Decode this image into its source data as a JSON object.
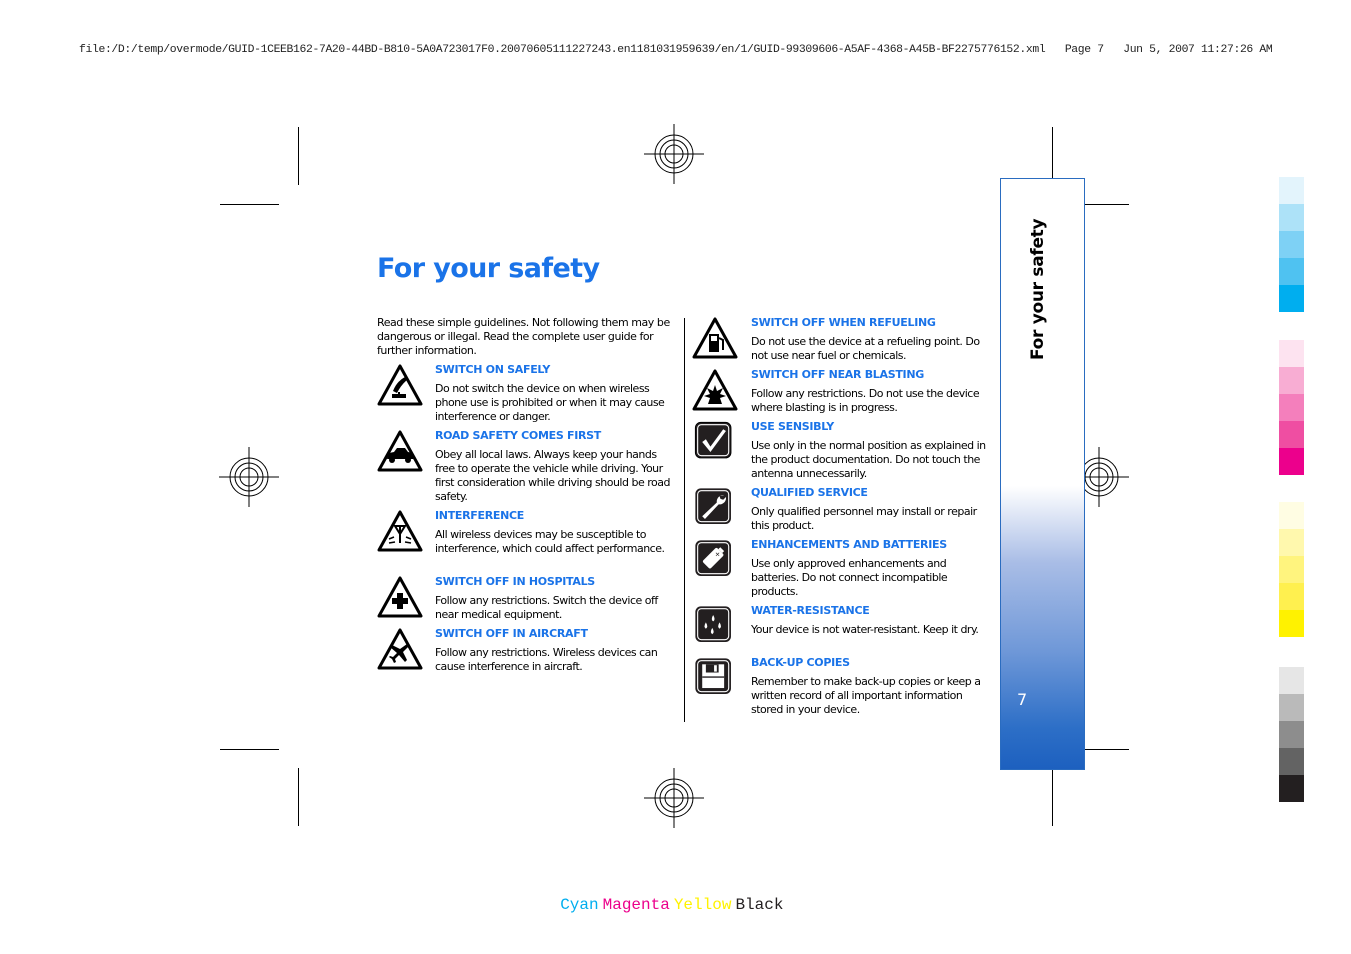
{
  "print_header": {
    "path": "file:/D:/temp/overmode/GUID-1CEEB162-7A20-44BD-B810-5A0A723017F0.20070605111227243.en1181031959639/en/1/GUID-99309606-A5AF-4368-A45B-BF2275776152.xml",
    "page": "Page 7",
    "timestamp": "Jun 5, 2007 11:27:26 AM"
  },
  "page": {
    "title": "For your safety",
    "intro": "Read these simple guidelines. Not following them may be dangerous or illegal. Read the complete user guide for further information.",
    "side_tab_label": "For your safety",
    "page_number": "7",
    "accent_color": "#1a73e8"
  },
  "left_items": [
    {
      "icon": "switch-on-safely-icon",
      "heading": "SWITCH ON SAFELY",
      "body": "Do not switch the device on when wireless phone use is prohibited or when it may cause interference or danger."
    },
    {
      "icon": "road-safety-car-icon",
      "heading": "ROAD SAFETY COMES FIRST",
      "body": "Obey all local laws. Always keep your hands free to operate the vehicle while driving. Your first consideration while driving should be road safety."
    },
    {
      "icon": "interference-antenna-icon",
      "heading": "INTERFERENCE",
      "body": "All wireless devices may be susceptible to interference, which could affect performance."
    },
    {
      "icon": "hospital-cross-icon",
      "heading": "SWITCH OFF IN HOSPITALS",
      "body": "Follow any restrictions. Switch the device off near medical equipment."
    },
    {
      "icon": "aircraft-icon",
      "heading": "SWITCH OFF IN AIRCRAFT",
      "body": "Follow any restrictions. Wireless devices can cause interference in aircraft."
    }
  ],
  "right_items": [
    {
      "icon": "fuel-pump-icon",
      "heading": "SWITCH OFF WHEN REFUELING",
      "body": "Do not use the device at a refueling point. Do not use near fuel or chemicals."
    },
    {
      "icon": "explosion-icon",
      "heading": "SWITCH OFF NEAR BLASTING",
      "body": "Follow any restrictions. Do not use the device where blasting is in progress."
    },
    {
      "icon": "checkmark-icon",
      "heading": "USE SENSIBLY",
      "body": "Use only in the normal position as explained in the product documentation. Do not touch the antenna unnecessarily."
    },
    {
      "icon": "wrench-icon",
      "heading": "QUALIFIED SERVICE",
      "body": "Only qualified personnel may install or repair this product."
    },
    {
      "icon": "battery-icon",
      "heading": "ENHANCEMENTS AND BATTERIES",
      "body": "Use only approved enhancements and batteries. Do not connect incompatible products."
    },
    {
      "icon": "water-drops-icon",
      "heading": "WATER-RESISTANCE",
      "body": "Your device is not water-resistant. Keep it dry."
    },
    {
      "icon": "floppy-disk-icon",
      "heading": "BACK-UP COPIES",
      "body": "Remember to make back-up copies or keep a written record of all important information stored in your device."
    }
  ],
  "color_bar": {
    "cyan": [
      "#e3f4fc",
      "#ade2f8",
      "#7ed1f5",
      "#4fc2f1",
      "#00aeef"
    ],
    "magenta": [
      "#fde3f0",
      "#f8add3",
      "#f47fbc",
      "#ef4ea2",
      "#ec008c"
    ],
    "yellow": [
      "#fffde3",
      "#fff8ad",
      "#fff47e",
      "#fff04f",
      "#fff200"
    ],
    "black": [
      "#e6e6e6",
      "#bababa",
      "#8d8d8d",
      "#636363",
      "#231f20"
    ]
  },
  "cmyk_legend": [
    {
      "label": "Cyan",
      "color": "#00aeef"
    },
    {
      "label": "Magenta",
      "color": "#ec008c"
    },
    {
      "label": "Yellow",
      "color": "#fff200"
    },
    {
      "label": "Black",
      "color": "#231f20"
    }
  ]
}
